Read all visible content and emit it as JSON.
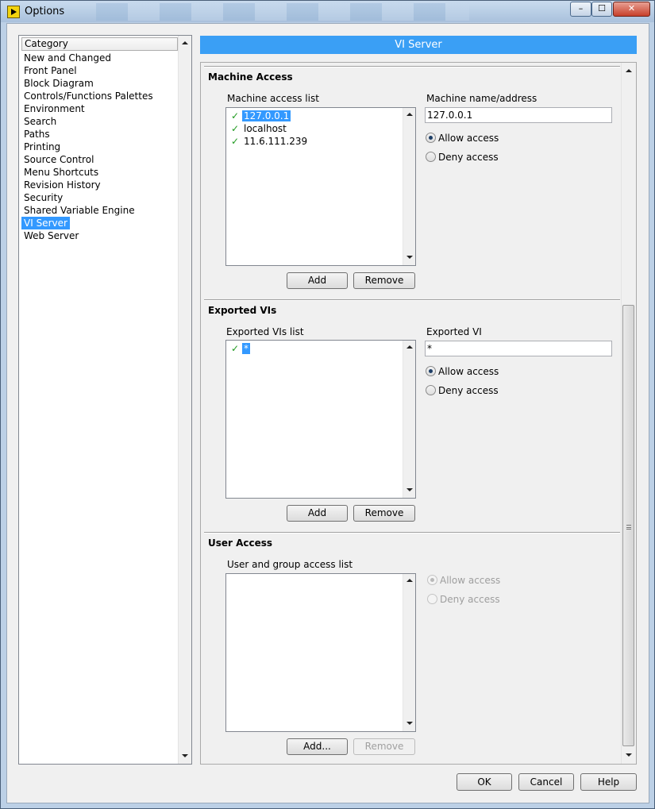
{
  "window": {
    "title": "Options",
    "close_glyph": "✕",
    "minimize_glyph": "–",
    "maximize_glyph": "☐"
  },
  "category": {
    "header": "Category",
    "selected": "VI Server",
    "items": [
      "New and Changed",
      "Front Panel",
      "Block Diagram",
      "Controls/Functions Palettes",
      "Environment",
      "Search",
      "Paths",
      "Printing",
      "Source Control",
      "Menu Shortcuts",
      "Revision History",
      "Security",
      "Shared Variable Engine",
      "VI Server",
      "Web Server"
    ]
  },
  "page_title": "VI Server",
  "machine_access": {
    "title": "Machine Access",
    "list_label": "Machine access list",
    "entries": [
      "127.0.0.1",
      "localhost",
      "11.6.111.239"
    ],
    "selected_entry": "127.0.0.1",
    "name_label": "Machine name/address",
    "name_value": "127.0.0.1",
    "allow_label": "Allow access",
    "deny_label": "Deny access",
    "allow_selected": true,
    "add_label": "Add",
    "remove_label": "Remove"
  },
  "exported_vis": {
    "title": "Exported VIs",
    "list_label": "Exported VIs list",
    "entries": [
      "*"
    ],
    "selected_entry": "*",
    "vi_label": "Exported VI",
    "vi_value": "*",
    "allow_label": "Allow access",
    "deny_label": "Deny access",
    "allow_selected": true,
    "add_label": "Add",
    "remove_label": "Remove"
  },
  "user_access": {
    "title": "User Access",
    "list_label": "User and group access list",
    "allow_label": "Allow access",
    "deny_label": "Deny access",
    "allow_selected": true,
    "controls_disabled": true,
    "add_label": "Add...",
    "remove_label": "Remove"
  },
  "footer": {
    "ok_label": "OK",
    "cancel_label": "Cancel",
    "help_label": "Help"
  },
  "icons": {
    "check": "✓",
    "app": "labview-icon"
  },
  "colors": {
    "selection": "#3399ff",
    "banner": "#3a9ff5",
    "check": "#1f9a1f"
  }
}
